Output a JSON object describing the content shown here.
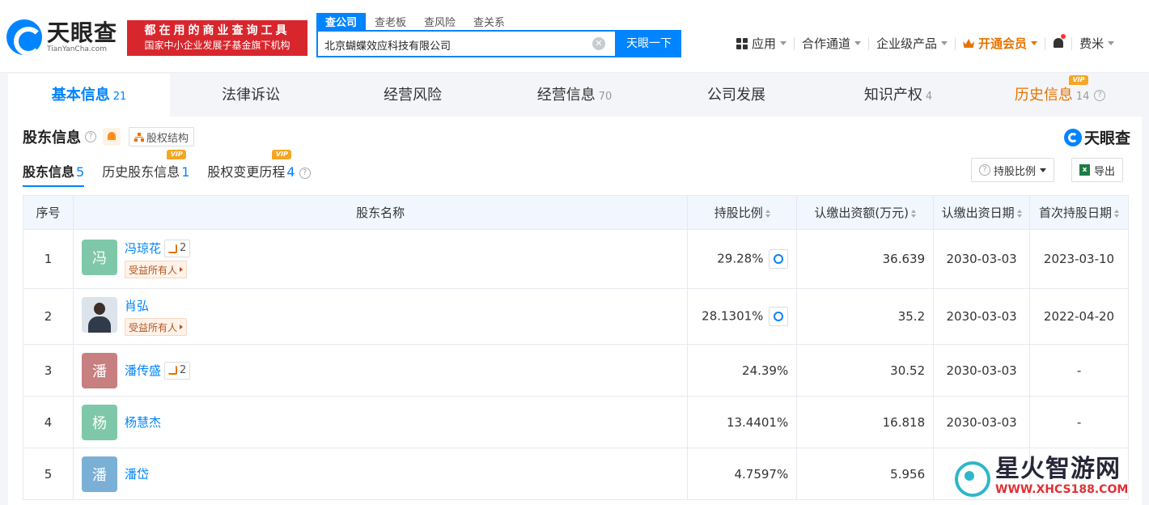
{
  "header": {
    "logo_cn": "天眼查",
    "logo_en": "TianYanCha.com",
    "banner_line1": "都在用的商业查询工具",
    "banner_line2": "国家中小企业发展子基金旗下机构",
    "search_tabs": [
      "查公司",
      "查老板",
      "查风险",
      "查关系"
    ],
    "search_value": "北京蝴蝶效应科技有限公司",
    "search_button": "天眼一下",
    "nav": {
      "apps": "应用",
      "partner": "合作通道",
      "enterprise": "企业级产品",
      "vip": "开通会员",
      "user": "费米"
    }
  },
  "tabs": [
    {
      "label": "基本信息",
      "count": "21"
    },
    {
      "label": "法律诉讼",
      "count": ""
    },
    {
      "label": "经营风险",
      "count": ""
    },
    {
      "label": "经营信息",
      "count": "70"
    },
    {
      "label": "公司发展",
      "count": ""
    },
    {
      "label": "知识产权",
      "count": "4"
    },
    {
      "label": "历史信息",
      "count": "14"
    }
  ],
  "section": {
    "title": "股东信息",
    "structure_button": "股权结构",
    "brand": "天眼查",
    "subtabs": [
      {
        "label": "股东信息",
        "count": "5"
      },
      {
        "label": "历史股东信息",
        "count": "1"
      },
      {
        "label": "股权变更历程",
        "count": "4"
      }
    ],
    "ratio_button": "持股比例",
    "export_button": "导出",
    "vip_badge": "VIP"
  },
  "table": {
    "headers": [
      "序号",
      "股东名称",
      "持股比例",
      "认缴出资额(万元)",
      "认缴出资日期",
      "首次持股日期"
    ],
    "beneficiary_tag": "受益所有人",
    "rows": [
      {
        "index": "1",
        "avatar": "冯",
        "name": "冯琼花",
        "relations": "2",
        "ratio": "29.28%",
        "amount": "36.639",
        "date": "2030-03-03",
        "first_date": "2023-03-10"
      },
      {
        "index": "2",
        "avatar": "",
        "name": "肖弘",
        "relations": "",
        "ratio": "28.1301%",
        "amount": "35.2",
        "date": "2030-03-03",
        "first_date": "2022-04-20"
      },
      {
        "index": "3",
        "avatar": "潘",
        "name": "潘传盛",
        "relations": "2",
        "ratio": "24.39%",
        "amount": "30.52",
        "date": "2030-03-03",
        "first_date": "-"
      },
      {
        "index": "4",
        "avatar": "杨",
        "name": "杨慧杰",
        "relations": "",
        "ratio": "13.4401%",
        "amount": "16.818",
        "date": "2030-03-03",
        "first_date": "-"
      },
      {
        "index": "5",
        "avatar": "潘",
        "name": "潘岱",
        "relations": "",
        "ratio": "4.7597%",
        "amount": "5.956",
        "date": "",
        "first_date": ""
      }
    ]
  },
  "watermark": {
    "cn": "星火智游网",
    "en": "WWW.XHCS188.COM"
  },
  "colors": {
    "accent": "#0084ff",
    "vip": "#e67300",
    "avatar_green": "#7ec8a9",
    "avatar_red": "#c77f80",
    "avatar_blue": "#7bb0d6"
  }
}
